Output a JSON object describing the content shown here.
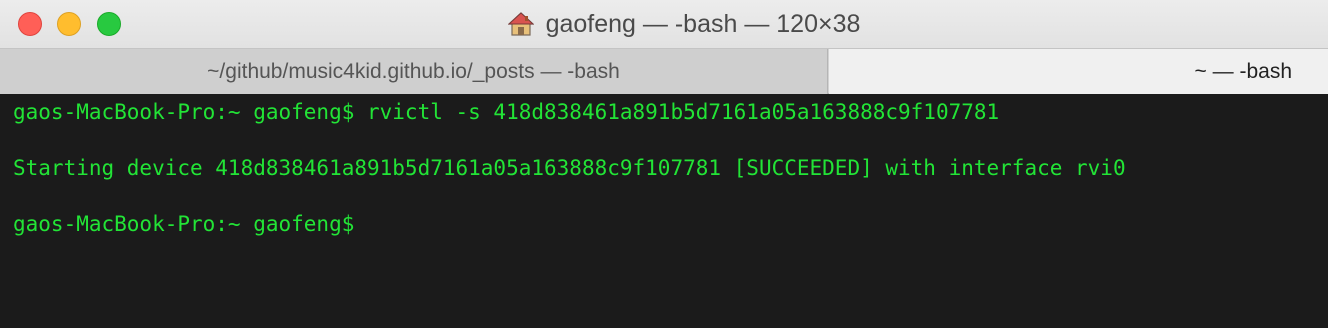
{
  "window": {
    "title": "gaofeng — -bash — 120×38"
  },
  "tabs": [
    {
      "label": "~/github/music4kid.github.io/_posts — -bash"
    },
    {
      "label": "~ — -bash"
    }
  ],
  "terminal": {
    "lines": [
      "gaos-MacBook-Pro:~ gaofeng$ rvictl -s 418d838461a891b5d7161a05a163888c9f107781",
      "",
      "Starting device 418d838461a891b5d7161a05a163888c9f107781 [SUCCEEDED] with interface rvi0",
      "",
      "gaos-MacBook-Pro:~ gaofeng$ "
    ]
  },
  "colors": {
    "terminal_text": "#22e436",
    "terminal_bg": "#1b1b1b",
    "close": "#ff5f57",
    "minimize": "#ffbd2e",
    "zoom": "#28c940"
  }
}
